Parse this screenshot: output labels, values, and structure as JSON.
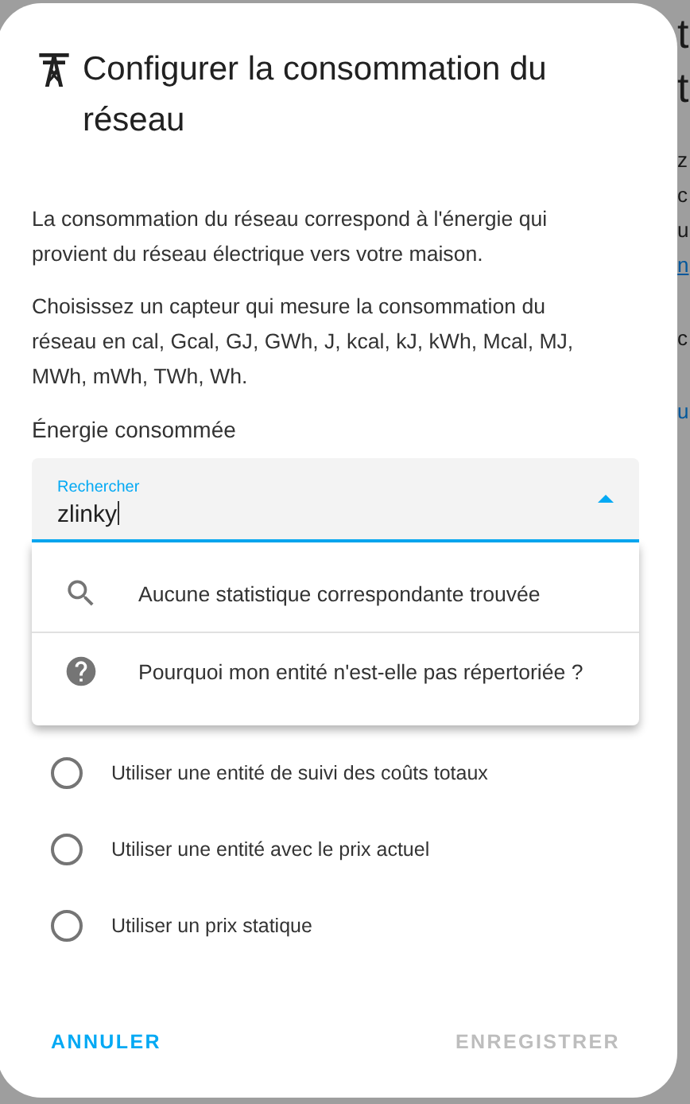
{
  "background": {
    "fragments": [
      {
        "text": "t",
        "kind": "heading"
      },
      {
        "text": "t",
        "kind": "heading"
      },
      {
        "text": "z",
        "kind": "text"
      },
      {
        "text": "c",
        "kind": "text"
      },
      {
        "text": "u",
        "kind": "text"
      },
      {
        "text": "n",
        "kind": "link"
      },
      {
        "text": "c",
        "kind": "text"
      },
      {
        "text": "u",
        "kind": "link"
      }
    ]
  },
  "dialog": {
    "title": "Configurer la consommation du réseau",
    "paragraphs": [
      "La consommation du réseau correspond à l'énergie qui provient du réseau électrique vers votre maison.",
      "Choisissez un capteur qui mesure la consommation du réseau en cal, Gcal, GJ, GWh, J, kcal, kJ, kWh, Mcal, MJ, MWh, mWh, TWh, Wh."
    ],
    "field_heading": "Énergie consommée",
    "search_field": {
      "label": "Rechercher",
      "value": "zlinky",
      "expanded": true
    },
    "menu_items": [
      {
        "kind": "search",
        "text": "Aucune statistique correspondante trouvée"
      },
      {
        "kind": "help",
        "text": "Pourquoi mon entité n'est-elle pas répertoriée ?"
      }
    ],
    "options": [
      {
        "label": "Utiliser une entité de suivi des coûts totaux",
        "selected": false
      },
      {
        "label": "Utiliser une entité avec le prix actuel",
        "selected": false
      },
      {
        "label": "Utiliser un prix statique",
        "selected": false
      }
    ],
    "buttons": [
      {
        "label": "ANNULER",
        "disabled": false
      },
      {
        "label": "ENREGISTRER",
        "disabled": true
      }
    ]
  }
}
